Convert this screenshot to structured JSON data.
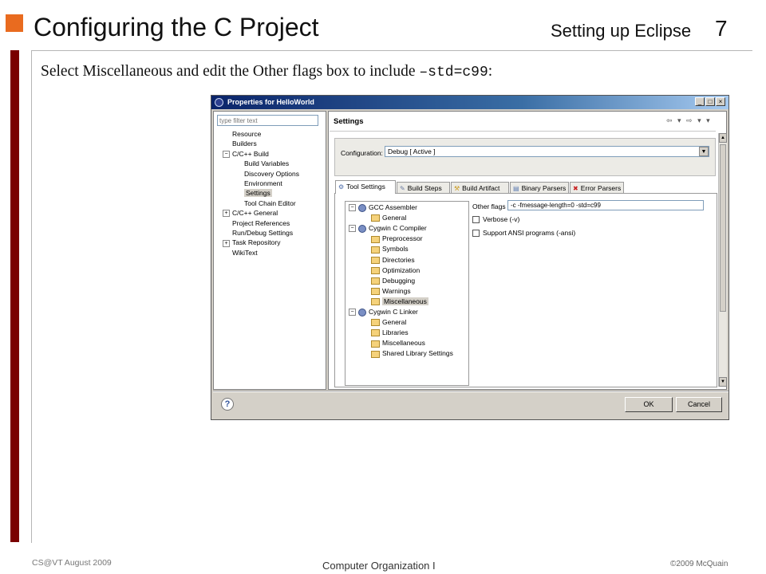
{
  "slide": {
    "title": "Configuring the C Project",
    "section": "Setting up Eclipse",
    "page_number": "7",
    "instruction_text": "Select Miscellaneous and edit the Other flags box to include ",
    "instruction_code": "–std=c99",
    "instruction_end": ":",
    "footer_left": "CS@VT August 2009",
    "footer_center": "Computer Organization I",
    "footer_right": "©2009  McQuain"
  },
  "dialog": {
    "title": "Properties for HelloWorld",
    "filter_placeholder": "type filter text",
    "nav_items": [
      {
        "label": "Resource"
      },
      {
        "label": "Builders"
      },
      {
        "label": "C/C++ Build",
        "expander": "−"
      },
      {
        "label": "Build Variables"
      },
      {
        "label": "Discovery Options"
      },
      {
        "label": "Environment"
      },
      {
        "label": "Settings",
        "selected": true
      },
      {
        "label": "Tool Chain Editor"
      },
      {
        "label": "C/C++ General",
        "expander": "+"
      },
      {
        "label": "Project References"
      },
      {
        "label": "Run/Debug Settings"
      },
      {
        "label": "Task Repository",
        "expander": "+"
      },
      {
        "label": "WikiText"
      }
    ],
    "page_title": "Settings",
    "nav_arrows": "⇦ ▾ ⇨ ▾ ▾",
    "configuration_label": "Configuration:",
    "configuration_value": "Debug  [ Active ]",
    "tabs": [
      {
        "label": "Tool Settings",
        "icon": "tool-settings-icon",
        "active": true
      },
      {
        "label": "Build Steps",
        "icon": "build-steps-icon"
      },
      {
        "label": "Build Artifact",
        "icon": "build-artifact-icon"
      },
      {
        "label": "Binary Parsers",
        "icon": "binary-parsers-icon"
      },
      {
        "label": "Error Parsers",
        "icon": "error-parsers-icon"
      }
    ],
    "tool_tree": [
      {
        "label": "GCC Assembler",
        "expander": "−",
        "kind": "tool"
      },
      {
        "label": "General",
        "kind": "category"
      },
      {
        "label": "Cygwin C Compiler",
        "expander": "−",
        "kind": "tool"
      },
      {
        "label": "Preprocessor",
        "kind": "category"
      },
      {
        "label": "Symbols",
        "kind": "category"
      },
      {
        "label": "Directories",
        "kind": "category"
      },
      {
        "label": "Optimization",
        "kind": "category"
      },
      {
        "label": "Debugging",
        "kind": "category"
      },
      {
        "label": "Warnings",
        "kind": "category"
      },
      {
        "label": "Miscellaneous",
        "kind": "category",
        "selected": true
      },
      {
        "label": "Cygwin C Linker",
        "expander": "−",
        "kind": "tool"
      },
      {
        "label": "General",
        "kind": "category"
      },
      {
        "label": "Libraries",
        "kind": "category"
      },
      {
        "label": "Miscellaneous",
        "kind": "category"
      },
      {
        "label": "Shared Library Settings",
        "kind": "category"
      }
    ],
    "other_flags_label": "Other flags",
    "other_flags_value": "-c -fmessage-length=0 -std=c99",
    "verbose_label": "Verbose (-v)",
    "verbose_checked": false,
    "ansi_label": "Support ANSI programs (-ansi)",
    "ansi_checked": false,
    "ok_label": "OK",
    "cancel_label": "Cancel"
  },
  "colors": {
    "accent_orange": "#e96b1f",
    "sidebar_bar": "#7a0000",
    "titlebar_dark": "#0a246a",
    "dialog_bg": "#d4d0c8"
  }
}
